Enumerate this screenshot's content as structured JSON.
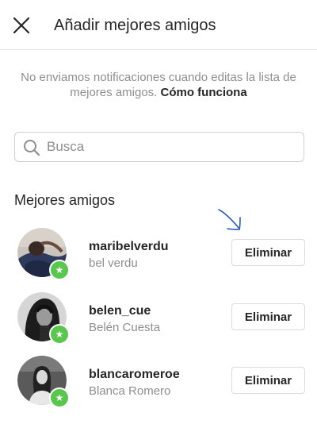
{
  "header": {
    "title": "Añadir mejores amigos"
  },
  "notice": {
    "text": "No enviamos notificaciones cuando editas la lista de mejores amigos.",
    "link": "Cómo funciona"
  },
  "search": {
    "placeholder": "Busca"
  },
  "section": {
    "title": "Mejores amigos"
  },
  "friends": [
    {
      "username": "maribelverdu",
      "fullname": "bel verdu",
      "button": "Eliminar"
    },
    {
      "username": "belen_cue",
      "fullname": "Belén Cuesta",
      "button": "Eliminar"
    },
    {
      "username": "blancaromeroe",
      "fullname": "Blanca Romero",
      "button": "Eliminar"
    }
  ],
  "colors": {
    "badge": "#5ac64e",
    "annotation": "#2b57c9"
  }
}
